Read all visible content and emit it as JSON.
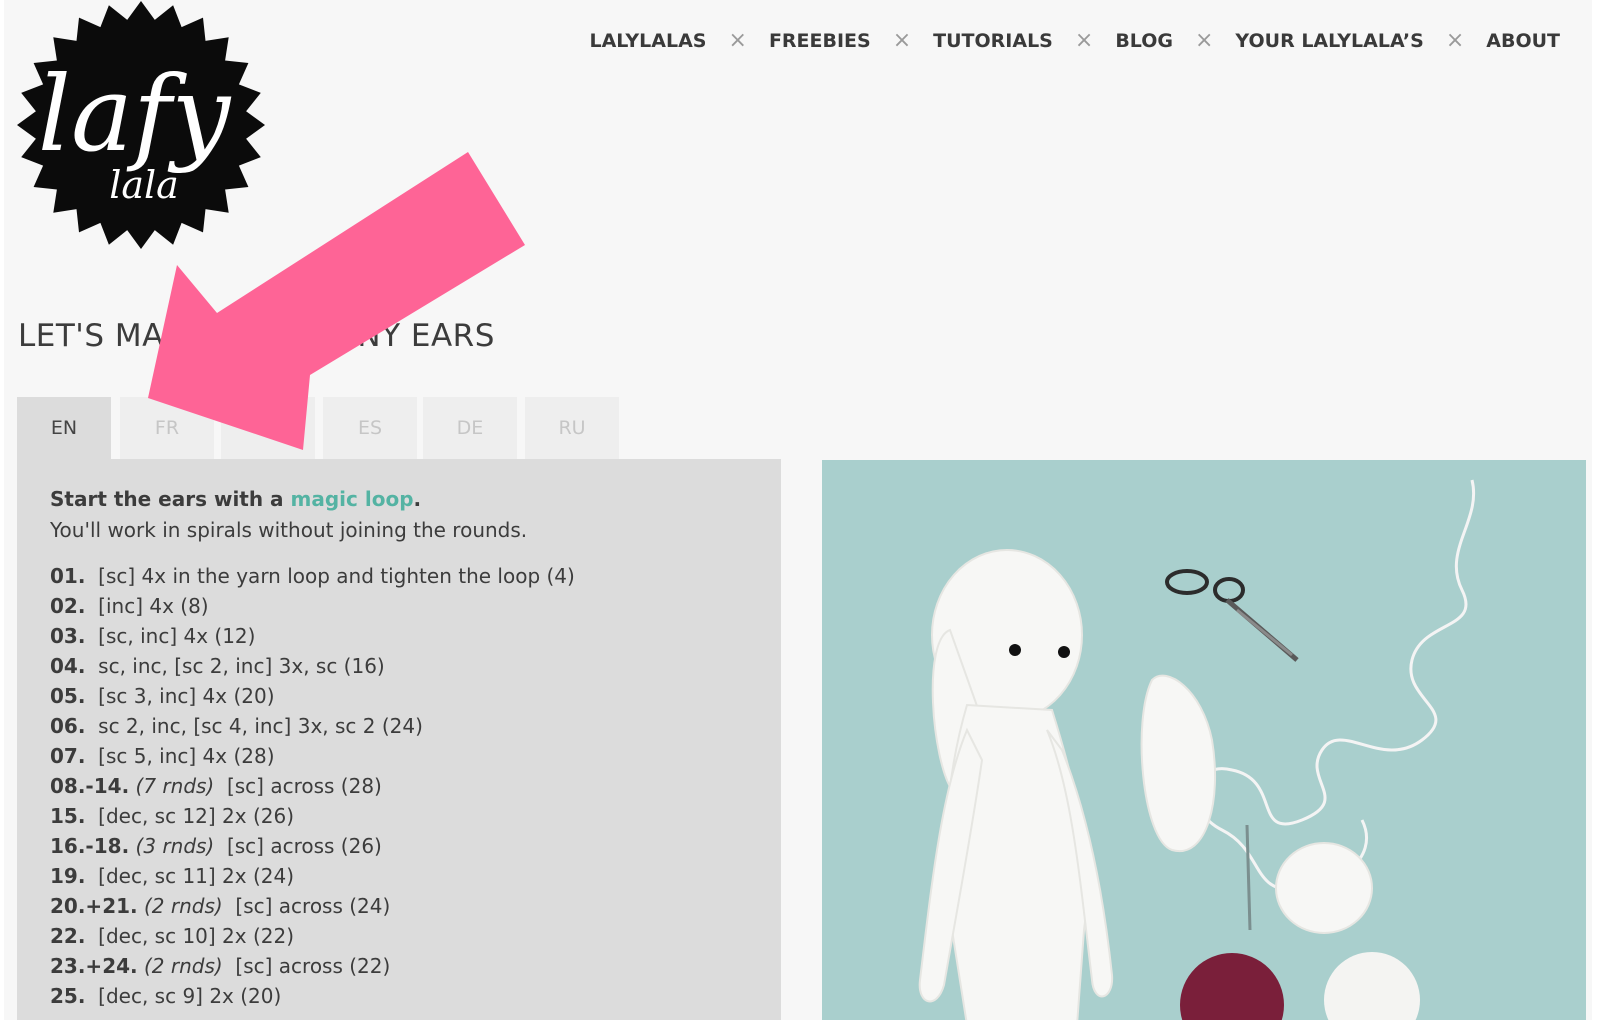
{
  "logo": {
    "text_main": "lafy",
    "text_sub": "lala"
  },
  "nav": {
    "items": [
      "LALYLALAS",
      "FREEBIES",
      "TUTORIALS",
      "BLOG",
      "YOUR LALYLALA’S",
      "ABOUT"
    ],
    "separator": "×"
  },
  "page": {
    "title": "LET'S MAKE THE BUNNY EARS"
  },
  "tabs": [
    "EN",
    "FR",
    "NL",
    "ES",
    "DE",
    "RU"
  ],
  "active_tab": "EN",
  "instructions": {
    "intro_bold": "Start the ears with a ",
    "intro_link": "magic loop",
    "intro_end": ".",
    "intro_line2": "You'll work in spirals without joining the rounds.",
    "rounds": [
      {
        "num": "01.",
        "note": "",
        "text": "[sc] 4x in the yarn loop and tighten the loop (4)"
      },
      {
        "num": "02.",
        "note": "",
        "text": "[inc] 4x (8)"
      },
      {
        "num": "03.",
        "note": "",
        "text": "[sc, inc] 4x (12)"
      },
      {
        "num": "04.",
        "note": "",
        "text": "sc, inc, [sc 2, inc] 3x, sc (16)"
      },
      {
        "num": "05.",
        "note": "",
        "text": "[sc 3, inc] 4x (20)"
      },
      {
        "num": "06.",
        "note": "",
        "text": "sc 2, inc, [sc 4, inc] 3x, sc 2 (24)"
      },
      {
        "num": "07.",
        "note": "",
        "text": "[sc 5, inc] 4x (28)"
      },
      {
        "num": "08.-14.",
        "note": "(7 rnds)",
        "text": "[sc] across (28)"
      },
      {
        "num": "15.",
        "note": "",
        "text": "[dec, sc 12] 2x (26)"
      },
      {
        "num": "16.-18.",
        "note": "(3 rnds)",
        "text": "[sc] across (26)"
      },
      {
        "num": "19.",
        "note": "",
        "text": "[dec, sc 11] 2x (24)"
      },
      {
        "num": "20.+21.",
        "note": "(2 rnds)",
        "text": "[sc] across (24)"
      },
      {
        "num": "22.",
        "note": "",
        "text": "[dec, sc 10] 2x (22)"
      },
      {
        "num": "23.+24.",
        "note": "(2 rnds)",
        "text": "[sc] across (22)"
      },
      {
        "num": "25.",
        "note": "",
        "text": "[dec, sc 9] 2x (20)"
      }
    ]
  },
  "colors": {
    "accent_link": "#54b3a3",
    "arrow": "#fe6496",
    "photo_bg": "#a9cfcd",
    "panel_bg": "#dcdcdc"
  }
}
